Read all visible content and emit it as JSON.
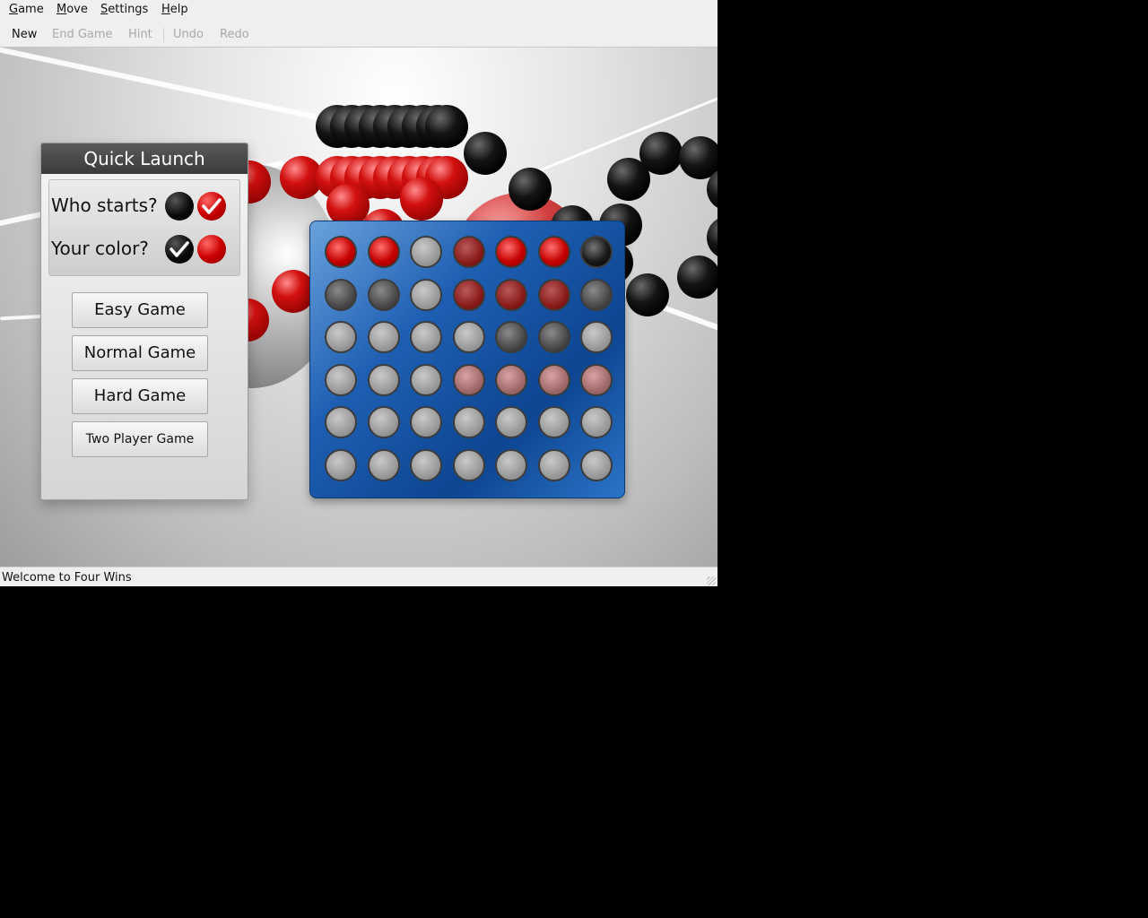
{
  "menubar": {
    "items": [
      {
        "accel": "G",
        "rest": "ame"
      },
      {
        "accel": "M",
        "rest": "ove"
      },
      {
        "accel": "S",
        "rest": "ettings"
      },
      {
        "accel": "H",
        "rest": "elp"
      }
    ]
  },
  "toolbar": {
    "new": "New",
    "end_game": "End Game",
    "hint": "Hint",
    "undo": "Undo",
    "redo": "Redo"
  },
  "quick_launch": {
    "title": "Quick Launch",
    "who_starts_label": "Who starts?",
    "who_starts_selected": "red",
    "your_color_label": "Your color?",
    "your_color_selected": "black",
    "buttons": {
      "easy": "Easy Game",
      "normal": "Normal Game",
      "hard": "Hard Game",
      "two_player": "Two Player Game"
    }
  },
  "board": {
    "rows": 6,
    "columns": 7,
    "cells": [
      [
        "red",
        "red",
        "empty",
        "darkred",
        "red",
        "red",
        "black"
      ],
      [
        "dark",
        "dark",
        "empty",
        "darkred",
        "darkred",
        "darkred",
        "dark"
      ],
      [
        "empty",
        "empty",
        "empty",
        "empty",
        "dark",
        "dark",
        "empty"
      ],
      [
        "empty",
        "empty",
        "empty",
        "pink",
        "pink",
        "pink",
        "pink"
      ],
      [
        "empty",
        "empty",
        "empty",
        "empty",
        "empty",
        "empty",
        "empty"
      ],
      [
        "empty",
        "empty",
        "empty",
        "empty",
        "empty",
        "empty",
        "empty"
      ]
    ]
  },
  "colors": {
    "piece_red": "#cc0000",
    "piece_black": "#000000",
    "board_blue": "#1e5fb3"
  },
  "status": {
    "text": "Welcome to Four Wins"
  }
}
